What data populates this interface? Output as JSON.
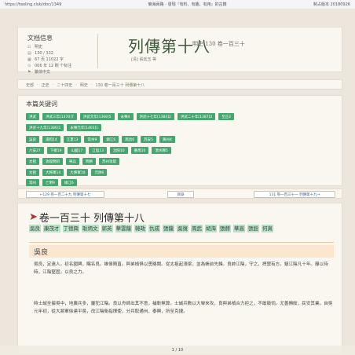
{
  "topbar": {
    "url": "https://taoling.club/doc/1349",
    "title": "簡海兩路 - 發現『有料、有趣、有用』的古籍",
    "date": "制占版本 20180926"
  },
  "header": {
    "info_title": "文档信息",
    "info": [
      {
        "icon": "☷",
        "text": "明史"
      },
      {
        "icon": "▤",
        "text": "130 / 332"
      },
      {
        "icon": "▦",
        "text": "67 页 11022 字"
      },
      {
        "icon": "⊙",
        "text": "006 年 12 刷 个标注"
      },
      {
        "icon": "⚑",
        "text": "繁体中文"
      }
    ],
    "title": "列傳第十八",
    "subtitle": "明史 130 卷一百三十",
    "author": "[清] 張廷玉 等"
  },
  "breadcrumb": [
    "史部",
    "正史",
    "二十四史",
    "明史",
    "130 卷一百三十 列傳第十八"
  ],
  "keywords": {
    "title": "本篇关键词",
    "rows": [
      [
        "洪武",
        "洪武三年[1370]7",
        "洪武元年[1368]5",
        "永樂4",
        "洪武十七年[1384]2",
        "洪武二十年[1387]2",
        "至正2"
      ],
      [
        "洪武十九年[1386]1",
        "永樂元年[1403]1"
      ],
      [
        "吳良",
        "湯和14",
        "江夏13",
        "常州9",
        "鎮江6",
        "南昌6",
        "苏安5",
        "黃州4"
      ],
      [
        "六安27",
        "下鄉19",
        "山國17",
        "江陰13",
        "沈阳10",
        "番禺10",
        "潛水縣5"
      ],
      [
        "太祖",
        "攻殺明初",
        "舉兵",
        "明勝",
        "苏州攻取"
      ],
      [
        "太祖",
        "大將軍14",
        "大將軍10",
        "元帥6"
      ],
      [
        "常州",
        "亡明9",
        "鎮江6"
      ]
    ]
  },
  "nav": {
    "prev": "←129 卷一百二十九 列傳第十七",
    "center": "目錄",
    "next": "131 卷一百三十一 列傳第十九→"
  },
  "main": {
    "chapter_title": "卷一百三十 列傳第十八",
    "people": [
      "吳良",
      "康茂才",
      "丁德興",
      "耿炳文",
      "郭英",
      "華雲龍",
      "韓政",
      "仇成",
      "張龍",
      "吳復",
      "周武",
      "胡海",
      "張赫",
      "華高",
      "張銓",
      "何真"
    ],
    "section": "吳良",
    "p1": "吳良，定遠人。初名國興，賜名良。雄偉剛直。與弟楨俱以勇略聞。從太祖起濠梁，並為帳前先鋒。良帥江陰，守之，捍禦有方。鎮江陰凡十年。靜以待時，江陰堅固，以良之力。",
    "p2": "時士誠全據吳中，地廣兵多，屢犯江陰。良以舟師出其不意，捕斬無算。士誠兵數以大舉來攻，良與弟楨合力拒之，不敢窺伺。尤善撫綏，民安其業。自吳元年初，從大將軍徐達平吳，改江陰衛指揮使，分兵取通州、泰興，所至克捷。"
  },
  "pager": "1 / 10"
}
